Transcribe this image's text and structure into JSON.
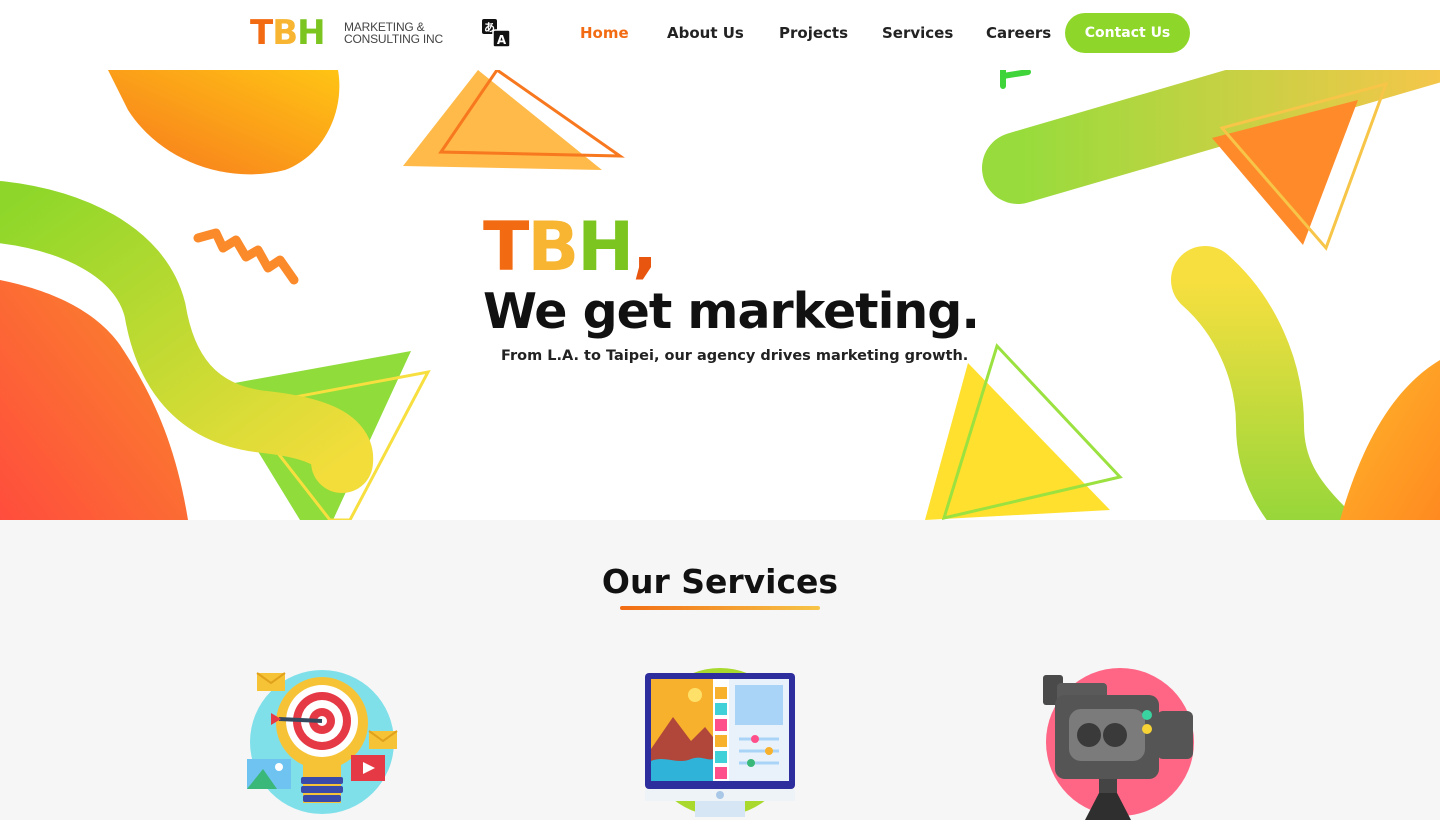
{
  "header": {
    "logo": {
      "letters": [
        "T",
        "B",
        "H"
      ],
      "letter_colors": [
        "#f26b12",
        "#f7b531",
        "#7cc520"
      ],
      "subtitle_line1": "MARKETING &",
      "subtitle_line2": "CONSULTING INC"
    },
    "translate_icon": "translate-icon",
    "nav": [
      {
        "label": "Home",
        "active": true
      },
      {
        "label": "About Us",
        "active": false
      },
      {
        "label": "Projects",
        "active": false
      },
      {
        "label": "Services",
        "active": false
      },
      {
        "label": "Careers",
        "active": false
      }
    ],
    "contact_label": "Contact Us"
  },
  "hero": {
    "brand_letters": [
      "T",
      "B",
      "H",
      ","
    ],
    "brand_colors": [
      "#f26b12",
      "#f7b531",
      "#7cc520",
      "#e8550f"
    ],
    "headline": "We get marketing.",
    "tagline": "From L.A. to Taipei, our agency drives marketing growth."
  },
  "services": {
    "title": "Our Services",
    "icons": [
      "marketing-strategy-icon",
      "web-design-icon",
      "video-production-icon"
    ]
  },
  "colors": {
    "accent_orange": "#f26b12",
    "accent_green": "#8ed72a",
    "accent_yellow": "#f7c548"
  }
}
